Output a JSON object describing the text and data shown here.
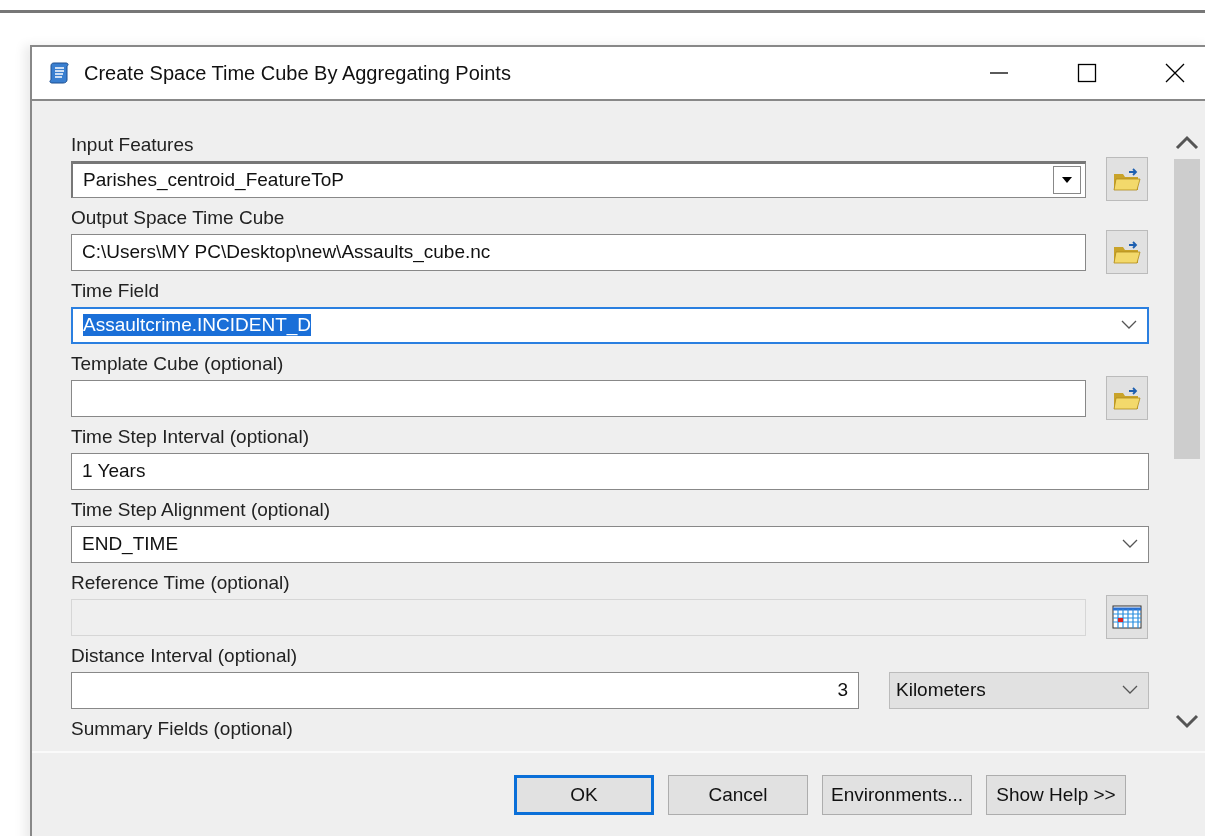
{
  "window": {
    "title": "Create Space Time Cube By Aggregating Points"
  },
  "parameters": [
    {
      "label": "Input Features",
      "kind": "combo",
      "value": "Parishes_centroid_FeatureToP",
      "browse": {
        "kind": "folder"
      },
      "focused": false,
      "disabled": false
    },
    {
      "label": "Output Space Time Cube",
      "kind": "text",
      "value": "C:\\Users\\MY PC\\Desktop\\new\\Assaults_cube.nc",
      "browse": {
        "kind": "folder"
      },
      "focused": false,
      "disabled": false
    },
    {
      "label": "Time Field",
      "kind": "dropdown",
      "value": "Assaultcrime.INCIDENT_D",
      "focused": true,
      "disabled": false
    },
    {
      "label": "Template Cube (optional)",
      "kind": "text",
      "browse": {
        "kind": "folder"
      },
      "focused": false,
      "disabled": false
    },
    {
      "label": "Time Step Interval (optional)",
      "kind": "text",
      "value": "1 Years",
      "focused": false,
      "disabled": false
    },
    {
      "label": "Time Step Alignment (optional)",
      "kind": "dropdown",
      "value": "END_TIME",
      "focused": false,
      "disabled": false
    },
    {
      "label": "Reference Time (optional)",
      "kind": "text",
      "browse": {
        "kind": "calendar"
      },
      "focused": false,
      "disabled": true
    },
    {
      "label": "Distance Interval (optional)",
      "kind": "number_unit",
      "value": "3",
      "unit": "Kilometers",
      "focused": false,
      "disabled": false
    },
    {
      "label": "Summary Fields (optional)",
      "kind": "label_only",
      "focused": false,
      "disabled": false
    }
  ],
  "buttons": [
    {
      "label": "OK",
      "default": true
    },
    {
      "label": "Cancel",
      "default": false
    },
    {
      "label": "Environments...",
      "default": false
    },
    {
      "label": "Show Help >>",
      "default": false
    }
  ]
}
